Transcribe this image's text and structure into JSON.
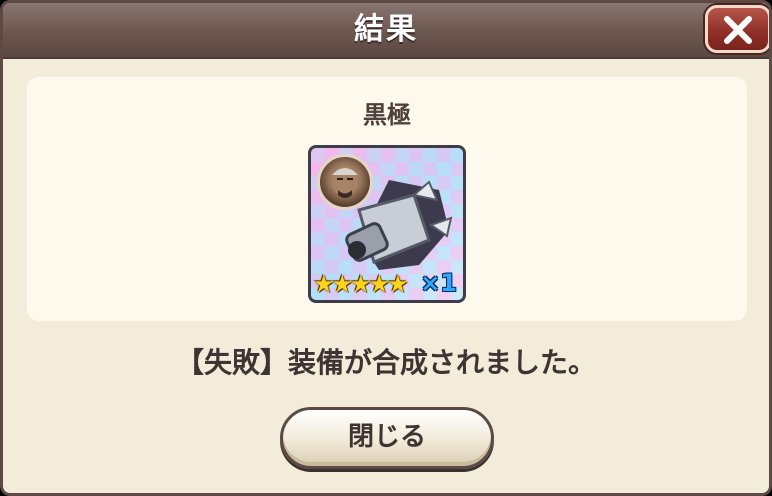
{
  "dialog": {
    "title": "結果",
    "close_icon": "close-x-icon"
  },
  "item": {
    "name": "黒極",
    "rarity_stars": "★★★★★",
    "star_count": 5,
    "count": "×1",
    "portrait_icon": "character-portrait-icon",
    "weapon_icon": "gauntlet-weapon-icon"
  },
  "message": "【失敗】装備が合成されました。",
  "buttons": {
    "close_label": "閉じる"
  },
  "colors": {
    "title_bar": "#6b5750",
    "close_button": "#8e2e27",
    "panel": "#fdf9ec",
    "background": "#f3ecdb",
    "star": "#ffd21e",
    "count": "#2fa7ff"
  }
}
